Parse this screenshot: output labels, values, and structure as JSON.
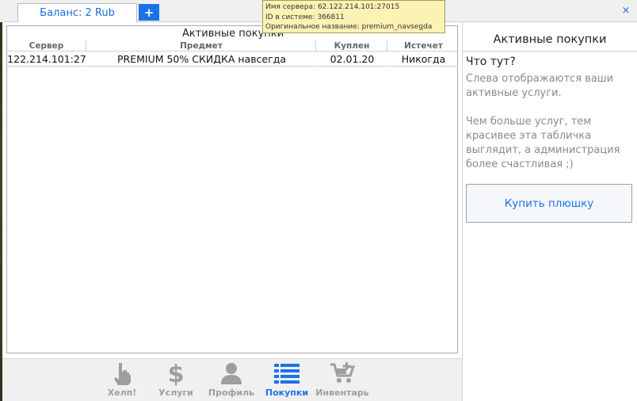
{
  "header": {
    "balance_tab": "Баланс: 2 Rub",
    "add_tab": "+",
    "close": "×"
  },
  "tooltip": {
    "line1": "Имя сервера: 62.122.214.101:27015",
    "line2": "ID в системе: 366811",
    "line3": "Оригинальное название: premium_navsegda"
  },
  "table": {
    "title": "Активные покупки",
    "columns": [
      "Сервер",
      "Предмет",
      "Куплен",
      "Истечет"
    ],
    "rows": [
      [
        "122.214.101:27",
        "PREMIUM 50% СКИДКА навсегда",
        "02.01.20",
        "Никогда"
      ]
    ]
  },
  "nav": {
    "items": [
      {
        "label": "Хелп!",
        "icon": "hand-pointer-icon"
      },
      {
        "label": "Услуги",
        "icon": "dollar-icon"
      },
      {
        "label": "Профиль",
        "icon": "user-icon"
      },
      {
        "label": "Покупки",
        "icon": "list-icon"
      },
      {
        "label": "Инвентарь",
        "icon": "cart-plus-icon"
      }
    ],
    "active": "Покупки"
  },
  "sidebar": {
    "title": "Активные покупки",
    "question": "Что тут?",
    "paragraph1": "Слева отображаются ваши активные услуги.",
    "paragraph2": "Чем больше услуг, тем красивее эта табличка выглядит, а администрация более счастливая ;)",
    "button": "Купить плюшку"
  },
  "colors": {
    "accent": "#1a73e8",
    "tooltip_bg": "#fbf2b4",
    "inactive_nav": "#9e9e9e"
  }
}
